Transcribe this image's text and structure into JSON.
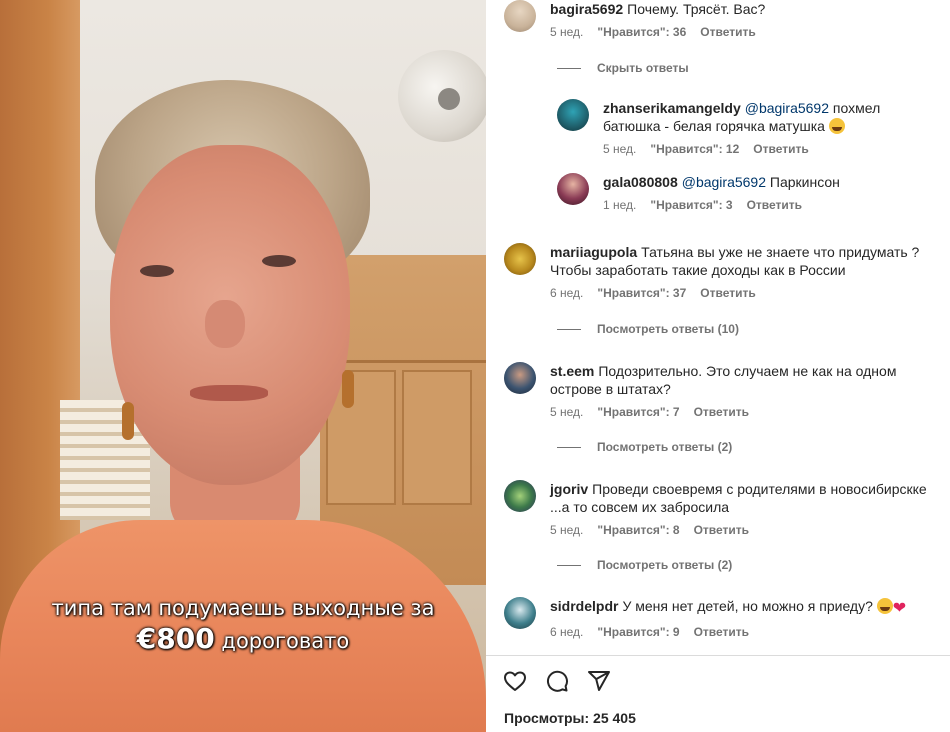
{
  "video": {
    "caption_line1": "типа там подумаешь выходные за",
    "caption_amount": "€800",
    "caption_rest": "дороговато"
  },
  "comments": [
    {
      "user": "bagira5692",
      "mention": "",
      "text": "Почему. Трясёт. Вас?",
      "time": "5 нед.",
      "likes": "\"Нравится\": 36",
      "reply": "Ответить",
      "avatar_color": "#c9b39a"
    },
    {
      "user": "zhanserikamangeldy",
      "mention": "@bagira5692",
      "text": "похмел батюшка - белая горячка матушка",
      "time": "5 нед.",
      "likes": "\"Нравится\": 12",
      "reply": "Ответить",
      "avatar_color": "#1f5f6b"
    },
    {
      "user": "gala080808",
      "mention": "@bagira5692",
      "text": "Паркинсон",
      "time": "1 нед.",
      "likes": "\"Нравится\": 3",
      "reply": "Ответить",
      "avatar_color": "#8a3b55"
    },
    {
      "user": "mariiagupola",
      "mention": "",
      "text": "Татьяна вы уже не знаете что придумать ? Чтобы заработать такие доходы как в России",
      "time": "6 нед.",
      "likes": "\"Нравится\": 37",
      "reply": "Ответить",
      "avatar_color": "#b8891e"
    },
    {
      "user": "st.eem",
      "mention": "",
      "text": "Подозрительно. Это случаем не как на одном острове в штатах?",
      "time": "5 нед.",
      "likes": "\"Нравится\": 7",
      "reply": "Ответить",
      "avatar_color": "#3c5470"
    },
    {
      "user": "jgoriv",
      "mention": "",
      "text": "Проведи своевремя с родителями в новосибирскке ...а то совсем их забросила",
      "time": "5 нед.",
      "likes": "\"Нравится\": 8",
      "reply": "Ответить",
      "avatar_color": "#3d7a4a"
    },
    {
      "user": "sidrdelpdr",
      "mention": "",
      "text": "У меня нет детей, но можно я приеду?",
      "time": "6 нед.",
      "likes": "\"Нравится\": 9",
      "reply": "Ответить",
      "avatar_color": "#3f7f8c"
    }
  ],
  "toggles": {
    "hide_replies": "Скрыть ответы",
    "view_replies_10": "Посмотреть ответы (10)",
    "view_replies_2a": "Посмотреть ответы (2)",
    "view_replies_2b": "Посмотреть ответы (2)"
  },
  "footer": {
    "views": "Просмотры: 25 405"
  },
  "icons": [
    "heart-icon",
    "comment-icon",
    "share-icon"
  ]
}
